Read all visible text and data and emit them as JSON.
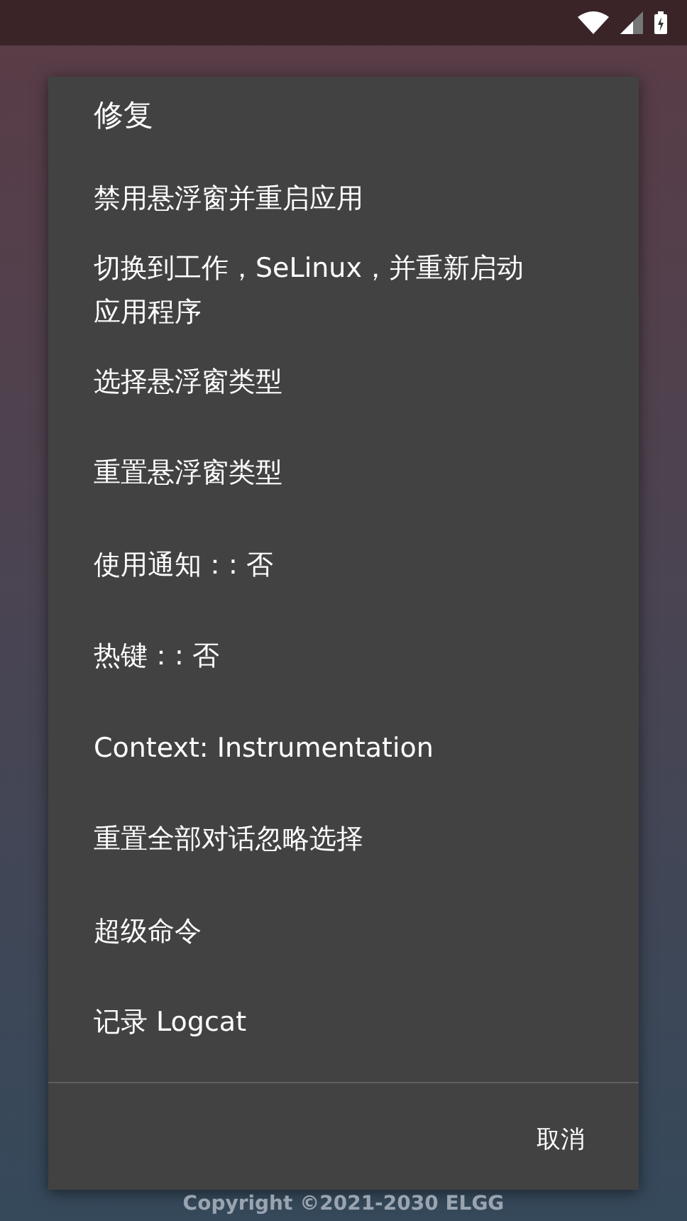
{
  "dialog": {
    "title": "修复",
    "items": [
      {
        "label": "禁用悬浮窗并重启应用"
      },
      {
        "label": "切换到工作，SeLinux，并重新启动应用程序"
      },
      {
        "label": "选择悬浮窗类型"
      },
      {
        "label": "重置悬浮窗类型"
      },
      {
        "label": "使用通知：: 否"
      },
      {
        "label": "热键：: 否"
      },
      {
        "label": "Context: Instrumentation"
      },
      {
        "label": "重置全部对话忽略选择"
      },
      {
        "label": "超级命令"
      },
      {
        "label": "记录 Logcat"
      }
    ],
    "buttons": [
      "取消"
    ]
  },
  "footer": {
    "copyright": "Copyright ©2021-2030 ELGG"
  }
}
